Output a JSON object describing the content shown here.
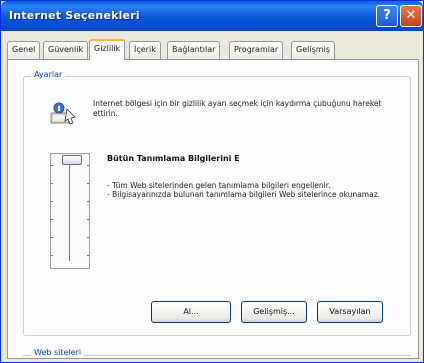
{
  "window": {
    "title": "Internet Seçenekleri",
    "help_label": "?",
    "close_label": "✕"
  },
  "tabs": [
    {
      "label": "Genel",
      "active": false
    },
    {
      "label": "Güvenlik",
      "active": false
    },
    {
      "label": "Gizlilik",
      "active": true
    },
    {
      "label": "İçerik",
      "active": false
    },
    {
      "label": "Bağlantılar",
      "active": false
    },
    {
      "label": "Programlar",
      "active": false
    },
    {
      "label": "Gelişmiş",
      "active": false
    }
  ],
  "settings_group": {
    "legend": "Ayarlar",
    "intro_text": "Internet bölgesi için bir gizlilik ayarı seçmek için kaydırma çubuğunu hareket ettirin.",
    "level_title": "Bütün Tanımlama Bilgilerini E",
    "level_lines": [
      "- Tüm Web sitelerinden gelen tanımlama bilgileri engellenir.",
      "- Bilgisayarınızda bulunan tanımlama bilgileri Web sitelerince okunamaz."
    ],
    "slider_level_fraction": 1.0
  },
  "buttons": {
    "import_label": "Al...",
    "advanced_label": "Gelişmiş...",
    "default_label": "Varsayılan"
  },
  "web_sites_group": {
    "legend": "Web siteleri"
  },
  "icons": {
    "info": "privacy-info-icon",
    "help": "help-icon",
    "close": "close-icon"
  },
  "colors": {
    "titlebar": "#0B57DA",
    "close_button": "#C7431A",
    "group_legend": "#0046D5",
    "active_tab_highlight": "#F6B934"
  }
}
